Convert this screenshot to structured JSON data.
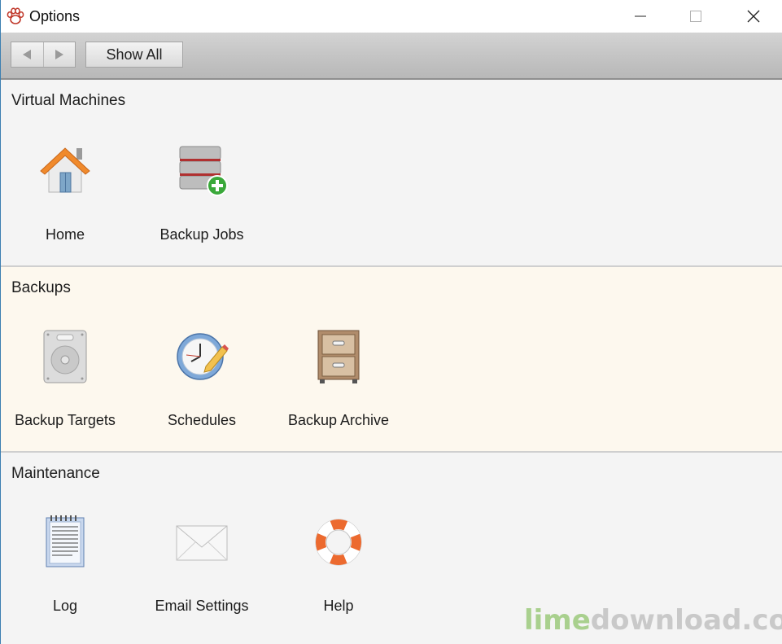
{
  "window": {
    "title": "Options"
  },
  "toolbar": {
    "back_icon": "left-triangle-icon",
    "forward_icon": "right-triangle-icon",
    "show_all_label": "Show All"
  },
  "sections": {
    "virtual_machines": {
      "title": "Virtual Machines",
      "items": [
        {
          "label": "Home",
          "icon": "home-icon"
        },
        {
          "label": "Backup Jobs",
          "icon": "database-add-icon"
        }
      ]
    },
    "backups": {
      "title": "Backups",
      "items": [
        {
          "label": "Backup Targets",
          "icon": "hard-drive-icon"
        },
        {
          "label": "Schedules",
          "icon": "clock-pencil-icon"
        },
        {
          "label": "Backup Archive",
          "icon": "file-cabinet-icon"
        }
      ]
    },
    "maintenance": {
      "title": "Maintenance",
      "items": [
        {
          "label": "Log",
          "icon": "notepad-icon"
        },
        {
          "label": "Email Settings",
          "icon": "envelope-icon"
        },
        {
          "label": "Help",
          "icon": "lifebuoy-icon"
        }
      ]
    }
  },
  "watermark": {
    "part1": "lime",
    "part2": "download.com"
  },
  "colors": {
    "backups_background": "#fdf8ee",
    "section_background": "#f4f4f4",
    "window_border": "#3c7fb1"
  }
}
